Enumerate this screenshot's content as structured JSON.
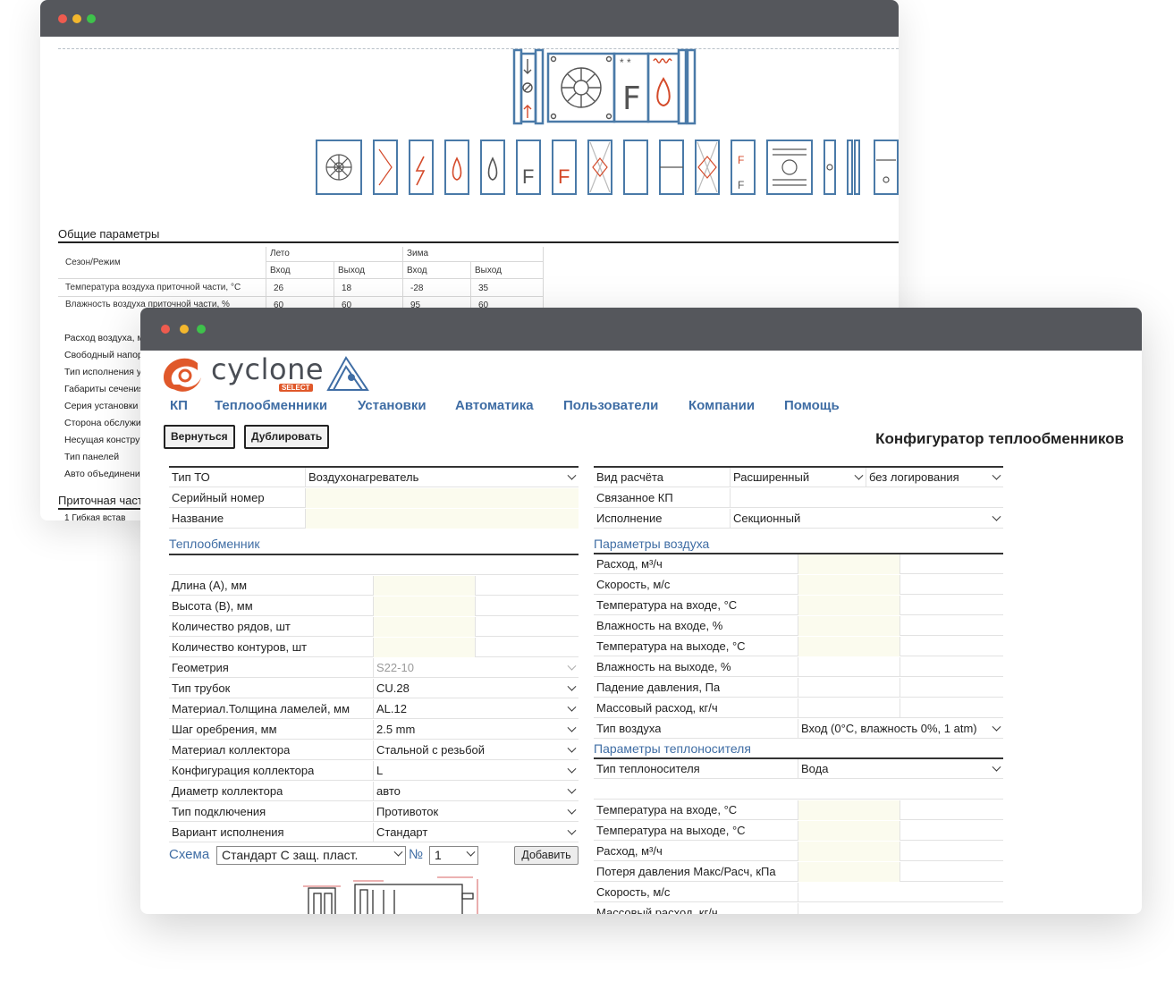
{
  "back_window": {
    "section_general": "Общие параметры",
    "table": {
      "season_label": "Сезон/Режим",
      "summer": "Лето",
      "winter": "Зима",
      "in": "Вход",
      "out": "Выход",
      "rows": [
        {
          "label": "Температура воздуха приточной части, °C",
          "values": [
            "26",
            "18",
            "-28",
            "35"
          ]
        },
        {
          "label": "Влажность воздуха приточной части, %",
          "values": [
            "60",
            "60",
            "95",
            "60"
          ]
        }
      ]
    },
    "list": [
      "Расход воздуха, м",
      "Свободный напор",
      "Тип исполнения у",
      "Габариты сечения",
      "Серия установки",
      "Сторона обслужи",
      "Несущая констру",
      "Тип панелей",
      "Авто объединени"
    ],
    "section_supply": "Приточная част",
    "last_row": "1   Гибкая встав"
  },
  "front_window": {
    "logo": {
      "word": "cyclone",
      "badge": "SELECT"
    },
    "nav": [
      "КП",
      "Теплообменники",
      "Установки",
      "Автоматика",
      "Пользователи",
      "Компании",
      "Помощь"
    ],
    "buttons": {
      "back": "Вернуться",
      "duplicate": "Дублировать"
    },
    "page_title": "Конфигуратор теплообменников",
    "left_top": [
      {
        "label": "Тип ТО",
        "value": "Воздухонагреватель"
      },
      {
        "label": "Серийный номер",
        "value": ""
      },
      {
        "label": "Название",
        "value": ""
      }
    ],
    "right_top": [
      {
        "label": "Вид расчёта",
        "value": "Расширенный",
        "value2": "без логирования"
      },
      {
        "label": "Связанное КП",
        "value": ""
      },
      {
        "label": "Исполнение",
        "value": "Секционный"
      }
    ],
    "heat_exchanger": {
      "title": "Теплообменник",
      "inputs": [
        "Длина (А), мм",
        "Высота (В), мм",
        "Количество рядов, шт",
        "Количество контуров, шт"
      ],
      "selects": [
        {
          "label": "Геометрия",
          "value": "S22-10"
        },
        {
          "label": "Тип трубок",
          "value": "CU.28"
        },
        {
          "label": "Материал.Толщина ламелей, мм",
          "value": "AL.12"
        },
        {
          "label": "Шаг оребрения, мм",
          "value": "2.5 mm"
        },
        {
          "label": "Материал коллектора",
          "value": "Стальной с резьбой"
        },
        {
          "label": "Конфигурация коллектора",
          "value": "L"
        },
        {
          "label": "Диаметр коллектора",
          "value": "авто"
        },
        {
          "label": "Тип подключения",
          "value": "Противоток"
        },
        {
          "label": "Вариант исполнения",
          "value": "Стандарт"
        }
      ]
    },
    "scheme": {
      "label": "Схема",
      "value": "Стандарт С защ. пласт.",
      "num_label": "№",
      "num_value": "1",
      "add_button": "Добавить"
    },
    "air_params": {
      "title": "Параметры воздуха",
      "rows": [
        "Расход, м³/ч",
        "Скорость, м/с",
        "Температура на входе, °C",
        "Влажность на входе, %",
        "Температура на выходе, °C",
        "Влажность на выходе, %",
        "Падение давления, Па",
        "Массовый расход, кг/ч"
      ],
      "air_type_label": "Тип воздуха",
      "air_type_value": "Вход (0°C, влажность 0%, 1 atm)"
    },
    "coolant_params": {
      "title": "Параметры теплоносителя",
      "type_label": "Тип теплоносителя",
      "type_value": "Вода",
      "rows": [
        "Температура на входе, °C",
        "Температура на выходе, °C",
        "Расход, м³/ч",
        "Потеря давления Макс/Расч, кПа",
        "Скорость, м/с",
        "Массовый расход, кг/ч"
      ]
    }
  }
}
